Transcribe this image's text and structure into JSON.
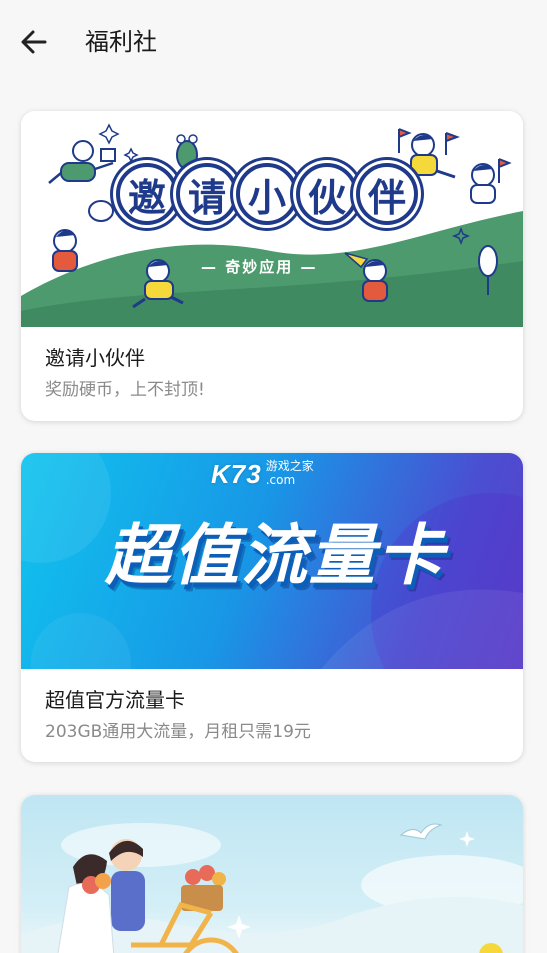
{
  "header": {
    "back_icon": "arrow-left-icon",
    "title": "福利社"
  },
  "cards": [
    {
      "title": "邀请小伙伴",
      "subtitle": "奖励硬币，上不封顶!",
      "banner": {
        "headline_chars": [
          "邀",
          "请",
          "小",
          "伙",
          "伴"
        ],
        "tagline": "— 奇妙应用 —",
        "colors": {
          "ink": "#1f3a8a",
          "grass": "#4c9a6e",
          "yellow": "#f5d93b",
          "red": "#e35a3c"
        }
      }
    },
    {
      "title": "超值官方流量卡",
      "subtitle": "203GB通用大流量，月租只需19元",
      "banner": {
        "headline": "超值流量卡",
        "watermark_main": "K73",
        "watermark_cn": "游戏之家",
        "watermark_en": ".com",
        "colors": {
          "start": "#10c4ee",
          "end": "#5a3fc8"
        }
      }
    },
    {
      "banner": {
        "scene": "couple-on-bicycle-illustration",
        "colors": {
          "sky": "#bfe6f3",
          "bike": "#f0b44a",
          "flowers": "#e86b5a"
        }
      }
    }
  ]
}
